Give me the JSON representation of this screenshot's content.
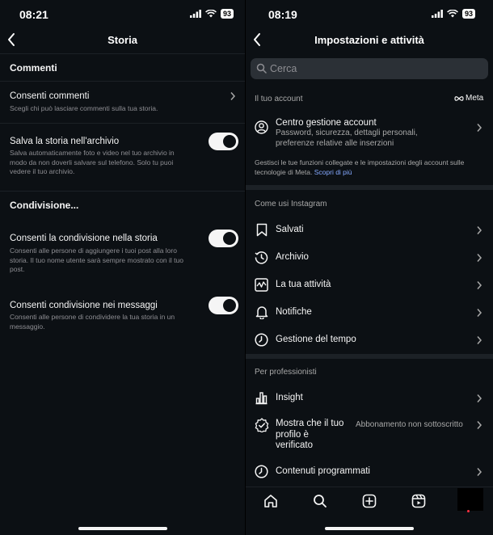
{
  "left": {
    "status": {
      "time": "08:21",
      "battery": "93"
    },
    "nav": {
      "title": "Storia"
    },
    "sections": {
      "comments_title": "Commenti",
      "sharing_title": "Condivisione..."
    },
    "rows": {
      "allow_comments": {
        "title": "Consenti commenti",
        "subtitle": "Scegli chi può lasciare commenti sulla tua storia."
      },
      "save_archive": {
        "title": "Salva la storia nell'archivio",
        "subtitle_lines": [
          "Salva automaticamente foto e video nel tuo archivio in",
          "modo da non doverli salvare sul telefono. Solo tu puoi",
          "vedere il tuo archivio."
        ],
        "enabled": true
      },
      "allow_story_sharing": {
        "title": "Consenti la condivisione nella storia",
        "subtitle_lines": [
          "Consenti alle persone di aggiungere i tuoi post alla loro",
          "storia. Il tuo nome utente sarà sempre mostrato con il tuo",
          "post."
        ],
        "enabled": true
      },
      "allow_message_sharing": {
        "title": "Consenti condivisione nei messaggi",
        "subtitle_lines": [
          "Consenti alle persone di condividere la tua storia in un",
          "messaggio."
        ],
        "enabled": true
      }
    }
  },
  "right": {
    "status": {
      "time": "08:19",
      "battery": "93"
    },
    "nav": {
      "title": "Impostazioni e attività"
    },
    "search": {
      "placeholder": "Cerca"
    },
    "your_account": {
      "label": "Il tuo account",
      "meta_logo": "Meta",
      "center": {
        "title": "Centro gestione account",
        "subtitle_lines": [
          "Password, sicurezza, dettagli personali,",
          "preferenze relative alle inserzioni"
        ]
      },
      "note_lines": [
        "Gestisci le tue funzioni collegate e le impostazioni degli account sulle",
        "tecnologie di Meta."
      ],
      "note_link": "Scopri di più"
    },
    "how_you_use": {
      "label": "Come usi Instagram",
      "items": [
        "Salvati",
        "Archivio",
        "La tua attività",
        "Notifiche",
        "Gestione del tempo"
      ]
    },
    "professionals": {
      "label": "Per professionisti",
      "insight": "Insight",
      "verified_lines": [
        "Mostra che il tuo",
        "profilo è",
        "verificato"
      ],
      "verified_value": "Abbonamento non sottoscritto",
      "scheduled": "Contenuti programmati"
    },
    "tabbar": {
      "icons": [
        "home-icon",
        "search-icon",
        "create-icon",
        "reels-icon",
        "profile-avatar"
      ]
    }
  }
}
